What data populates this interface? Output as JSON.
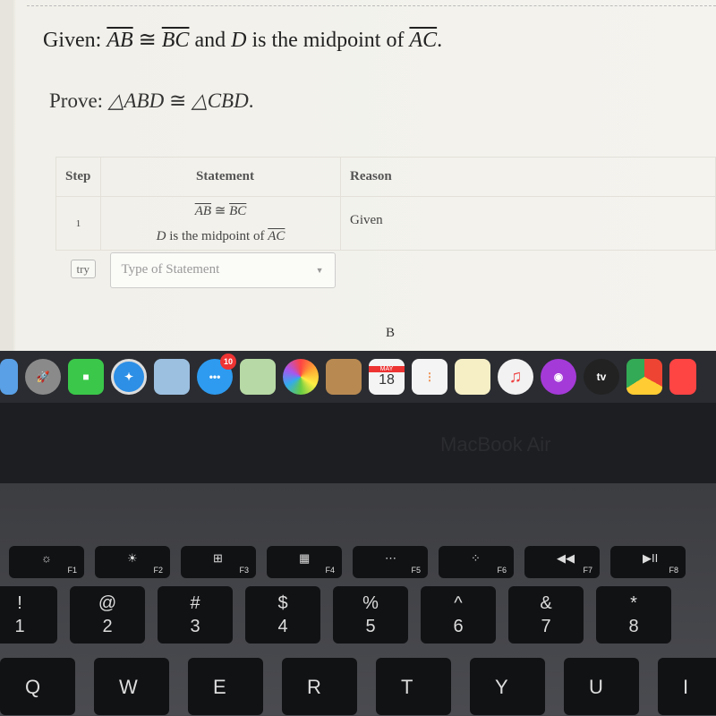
{
  "given": {
    "prefix": "Given: ",
    "seg1": "AB",
    "cong": " ≅ ",
    "seg2": "BC",
    "mid": " and ",
    "pt": "D",
    "mid2": " is the midpoint of ",
    "seg3": "AC",
    "end": "."
  },
  "prove": {
    "prefix": "Prove: ",
    "t1": "△ABD",
    "cong": " ≅ ",
    "t2": "△CBD",
    "end": "."
  },
  "table": {
    "headers": [
      "Step",
      "Statement",
      "Reason"
    ],
    "rows": [
      {
        "step": "1",
        "line1_a": "AB",
        "line1_cong": " ≅ ",
        "line1_b": "BC",
        "line2_pt": "D",
        "line2_text": " is the midpoint of ",
        "line2_seg": "AC",
        "reason": "Given"
      }
    ],
    "try_label": "try",
    "select_placeholder": "Type of Statement"
  },
  "diagram_label": "B",
  "dock": {
    "apps": [
      "finder",
      "launchpad",
      "facetime",
      "safari",
      "preview",
      "messages",
      "maps",
      "photos",
      "contacts",
      "calendar",
      "reminders",
      "notes",
      "music",
      "podcasts",
      "apple-tv",
      "chrome",
      "news"
    ],
    "messages_badge": "10",
    "calendar_month": "MAY",
    "calendar_day": "18",
    "tv_label": "tv"
  },
  "bezel_label": "MacBook Air",
  "keyboard": {
    "fkeys": [
      {
        "g": "☼",
        "l": "F1"
      },
      {
        "g": "☀",
        "l": "F2"
      },
      {
        "g": "⊞",
        "l": "F3"
      },
      {
        "g": "▦",
        "l": "F4"
      },
      {
        "g": "⋯",
        "l": "F5"
      },
      {
        "g": "⁘",
        "l": "F6"
      },
      {
        "g": "◀◀",
        "l": "F7"
      },
      {
        "g": "▶II",
        "l": "F8"
      }
    ],
    "numkeys": [
      {
        "t": "!",
        "b": "1"
      },
      {
        "t": "@",
        "b": "2"
      },
      {
        "t": "#",
        "b": "3"
      },
      {
        "t": "$",
        "b": "4"
      },
      {
        "t": "%",
        "b": "5"
      },
      {
        "t": "^",
        "b": "6"
      },
      {
        "t": "&",
        "b": "7"
      },
      {
        "t": "*",
        "b": "8"
      }
    ],
    "letters": [
      "Q",
      "W",
      "E",
      "R",
      "T",
      "Y",
      "U",
      "I"
    ]
  },
  "colors": {
    "screen_bg": "#f4f3ee",
    "dock_bg": "#2a2c31",
    "key": "#111214"
  }
}
